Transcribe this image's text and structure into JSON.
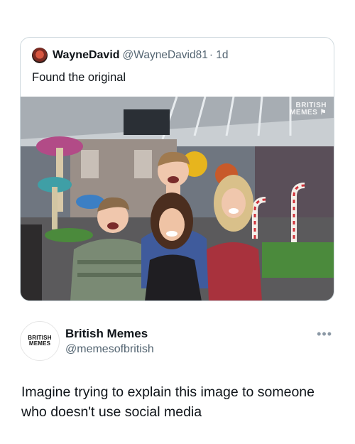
{
  "quoted_tweet": {
    "author_name": "WayneDavid",
    "author_handle": "@WayneDavid81",
    "time": "· 1d",
    "text": "Found the original",
    "watermark": [
      "BRITISH",
      "MEMES"
    ]
  },
  "post": {
    "author_name": "British Memes",
    "author_handle": "@memesofbritish",
    "avatar_text": [
      "BRITISH",
      "MEMES"
    ],
    "more_icon": "more-icon",
    "body": "Imagine trying to explain this image to someone who doesn't use social media"
  },
  "colors": {
    "secondary_text": "#536471",
    "border": "#cfd9de",
    "text": "#0f1419"
  }
}
